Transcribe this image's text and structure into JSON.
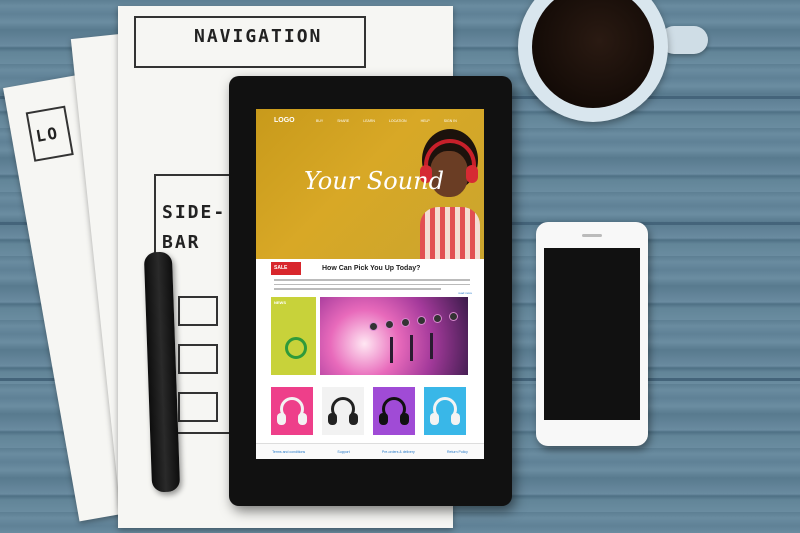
{
  "sketch": {
    "navigation_label": "NAVIGATION",
    "sidebar_label_1": "SIDE-",
    "sidebar_label_2": "BAR",
    "lo_label": "LO"
  },
  "site": {
    "logo": "LOGO",
    "nav": [
      "BUY",
      "SHARE",
      "LEARN",
      "LOCATION",
      "HELP",
      "SIGN IN"
    ],
    "hero_title": "Your Sound",
    "sale_badge": "SALE",
    "sale_heading": "How Can Pick You Up Today?",
    "read_more": "read more",
    "news_label": "NEWS",
    "footer_links": [
      "Terms and conditions",
      "Support",
      "Pre-orders & delivery",
      "Return Policy"
    ]
  },
  "colors": {
    "hero": "#d8a826",
    "sale": "#d8262c",
    "mixer": "#e86abb",
    "thumbs": [
      "#ee3f8a",
      "#f2f2f2",
      "#a04bd6",
      "#39b7e8"
    ]
  }
}
